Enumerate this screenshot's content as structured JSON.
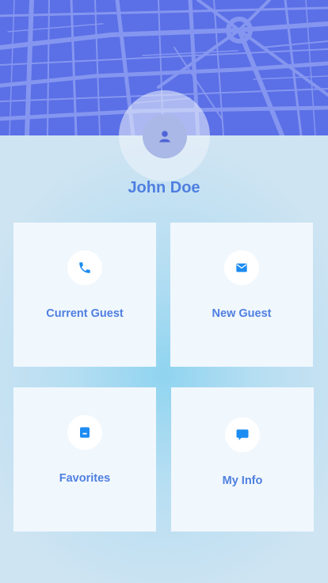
{
  "profile": {
    "name": "John Doe"
  },
  "tiles": [
    {
      "label": "Current Guest",
      "icon": "phone-icon"
    },
    {
      "label": "New Guest",
      "icon": "mail-icon"
    },
    {
      "label": "Favorites",
      "icon": "bookmark-icon"
    },
    {
      "label": "My Info",
      "icon": "chat-icon"
    }
  ],
  "colors": {
    "header_map": "#5b6fe6",
    "accent_text": "#4f7fe0",
    "icon_blue": "#1d8cf2",
    "tile_bg": "#f0f7fd"
  }
}
